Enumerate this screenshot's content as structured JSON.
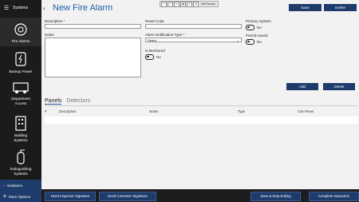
{
  "sidebar": {
    "header_label": "Systems",
    "items": [
      {
        "label": "Fire Alarms",
        "icon": "fire-alarm-icon"
      },
      {
        "label": "Backup Power",
        "icon": "battery-icon"
      },
      {
        "label": "Department Access",
        "icon": "truck-icon"
      },
      {
        "label": "Building Systems",
        "icon": "building-icon"
      },
      {
        "label": "Extinguishing Systems",
        "icon": "extinguisher-icon"
      }
    ],
    "violations_label": "Violations",
    "more_options_label": "More Options"
  },
  "header": {
    "title": "New Fire Alarm",
    "toolbar_status": "Not Reload",
    "save_label": "Save",
    "delete_label": "Delete"
  },
  "form": {
    "description_label": "Description",
    "required_mark": "*",
    "description_value": "",
    "notes_label": "Notes",
    "reset_code_label": "Reset Code",
    "reset_code_value": "",
    "notification_type_label": "Alarm Notification Type",
    "notification_type_value": "Select",
    "is_monitored_label": "Is Monitored",
    "is_monitored_value": "No",
    "primary_system_label": "Primary System",
    "primary_system_value": "No",
    "permit_issued_label": "Permit Issued",
    "permit_issued_value": "No",
    "add_label": "Add",
    "delete_label": "Delete"
  },
  "tabs": [
    "Panels",
    "Detectors"
  ],
  "grid": {
    "columns": [
      "#",
      "Description",
      "Notes",
      "Type",
      "Can Reset"
    ],
    "rows": []
  },
  "footer": {
    "need_inspector_signature": "Need Inspector Signature",
    "need_customer_signature": "Need Customer Signature",
    "save_stop_editing": "Save & Stop Editing",
    "complete_inspection": "Complete Inspection"
  },
  "colors": {
    "accent": "#1d3b6b",
    "title": "#1d5fa6",
    "sidebar": "#1b1b1b"
  }
}
